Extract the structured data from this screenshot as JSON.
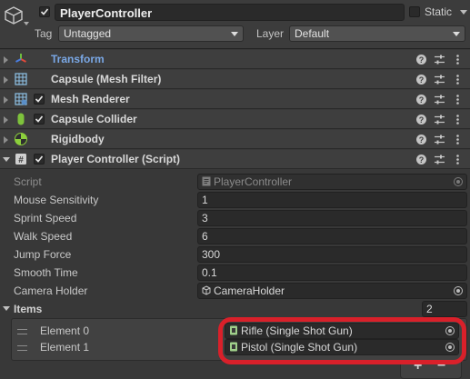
{
  "header": {
    "object_name": "PlayerController",
    "active_checked": true,
    "static_label": "Static",
    "tag_label": "Tag",
    "tag_value": "Untagged",
    "layer_label": "Layer",
    "layer_value": "Default"
  },
  "components": [
    {
      "name": "Transform",
      "icon": "transform-icon",
      "has_checkbox": false,
      "expanded": false
    },
    {
      "name": "Capsule (Mesh Filter)",
      "icon": "mesh-filter-icon",
      "has_checkbox": false,
      "expanded": false
    },
    {
      "name": "Mesh Renderer",
      "icon": "mesh-renderer-icon",
      "has_checkbox": true,
      "checked": true,
      "expanded": false
    },
    {
      "name": "Capsule Collider",
      "icon": "capsule-collider-icon",
      "has_checkbox": true,
      "checked": true,
      "expanded": false
    },
    {
      "name": "Rigidbody",
      "icon": "rigidbody-icon",
      "has_checkbox": false,
      "expanded": false
    },
    {
      "name": "Player Controller (Script)",
      "icon": "script-icon",
      "has_checkbox": true,
      "checked": true,
      "expanded": true
    }
  ],
  "script_props": {
    "script": {
      "label": "Script",
      "value": "PlayerController"
    },
    "mouse_sensitivity": {
      "label": "Mouse Sensitivity",
      "value": "1"
    },
    "sprint_speed": {
      "label": "Sprint Speed",
      "value": "3"
    },
    "walk_speed": {
      "label": "Walk Speed",
      "value": "6"
    },
    "jump_force": {
      "label": "Jump Force",
      "value": "300"
    },
    "smooth_time": {
      "label": "Smooth Time",
      "value": "0.1"
    },
    "camera_holder": {
      "label": "Camera Holder",
      "value": "CameraHolder"
    }
  },
  "items": {
    "label": "Items",
    "count": "2",
    "elements": [
      {
        "label": "Element 0",
        "value": "Rifle (Single Shot Gun)"
      },
      {
        "label": "Element 1",
        "value": "Pistol (Single Shot Gun)"
      }
    ],
    "add_symbol": "+",
    "remove_symbol": "−"
  },
  "colors": {
    "highlight": "#d9202a",
    "transform_label": "#7aa8e6"
  }
}
